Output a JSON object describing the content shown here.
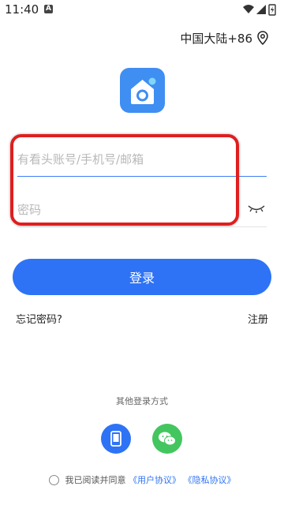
{
  "status_bar": {
    "time": "11:40",
    "notif_letter": "A"
  },
  "region": {
    "label": "中国大陆+86"
  },
  "form": {
    "account_placeholder": "有看头账号/手机号/邮箱",
    "password_placeholder": "密码"
  },
  "actions": {
    "login_label": "登录",
    "forgot_label": "忘记密码?",
    "register_label": "注册"
  },
  "other_login": {
    "title": "其他登录方式"
  },
  "agreement": {
    "text": "我已阅读并同意",
    "user_agreement": "《用户协议》",
    "privacy_agreement": "《隐私协议》"
  },
  "colors": {
    "accent": "#2e73f5",
    "logo_bg": "#3f8ef2",
    "wechat": "#43c65f",
    "highlight": "#e01e1e"
  }
}
